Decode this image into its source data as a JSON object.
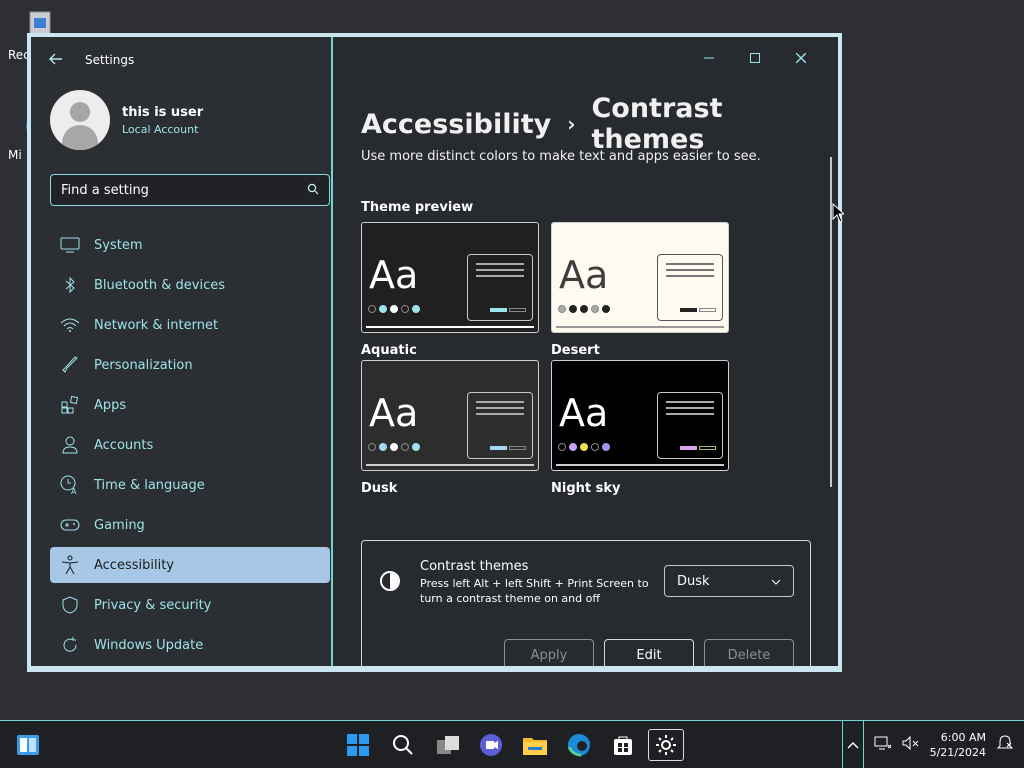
{
  "desktop": {
    "icons": [
      {
        "label": "Rec"
      },
      {
        "label": "Mi"
      }
    ]
  },
  "window": {
    "app_title": "Settings",
    "profile": {
      "name": "this is user",
      "account_type": "Local Account"
    },
    "search": {
      "placeholder": "Find a setting"
    },
    "nav": [
      {
        "label": "System",
        "icon": "monitor-icon"
      },
      {
        "label": "Bluetooth & devices",
        "icon": "bluetooth-icon"
      },
      {
        "label": "Network & internet",
        "icon": "wifi-icon"
      },
      {
        "label": "Personalization",
        "icon": "brush-icon"
      },
      {
        "label": "Apps",
        "icon": "apps-icon"
      },
      {
        "label": "Accounts",
        "icon": "person-icon"
      },
      {
        "label": "Time & language",
        "icon": "clock-language-icon"
      },
      {
        "label": "Gaming",
        "icon": "gamepad-icon"
      },
      {
        "label": "Accessibility",
        "icon": "accessibility-icon",
        "active": true
      },
      {
        "label": "Privacy & security",
        "icon": "shield-icon"
      },
      {
        "label": "Windows Update",
        "icon": "update-icon"
      }
    ],
    "breadcrumb": {
      "parent": "Accessibility",
      "current": "Contrast themes"
    },
    "description": "Use more distinct colors to make text and apps easier to see.",
    "theme_preview_label": "Theme preview",
    "themes": [
      {
        "name": "Aquatic",
        "sample": "Aa",
        "bg": "#202020",
        "text": "#ffffff"
      },
      {
        "name": "Desert",
        "sample": "Aa",
        "bg": "#fffaef",
        "text": "#3d3d3d"
      },
      {
        "name": "Dusk",
        "sample": "Aa",
        "bg": "#2d2d2d",
        "text": "#ffffff"
      },
      {
        "name": "Night sky",
        "sample": "Aa",
        "bg": "#000000",
        "text": "#ffffff"
      }
    ],
    "contrast_panel": {
      "title": "Contrast themes",
      "subtitle": "Press left Alt + left Shift + Print Screen to turn a contrast theme on and off",
      "selected_theme": "Dusk",
      "apply_label": "Apply",
      "edit_label": "Edit",
      "delete_label": "Delete"
    }
  },
  "taskbar": {
    "time": "6:00 AM",
    "date": "5/21/2024"
  },
  "colors": {
    "accent_border": "#6fd6cf",
    "nav_text": "#9ee3ea",
    "active_nav_bg": "#a6c7e6"
  }
}
